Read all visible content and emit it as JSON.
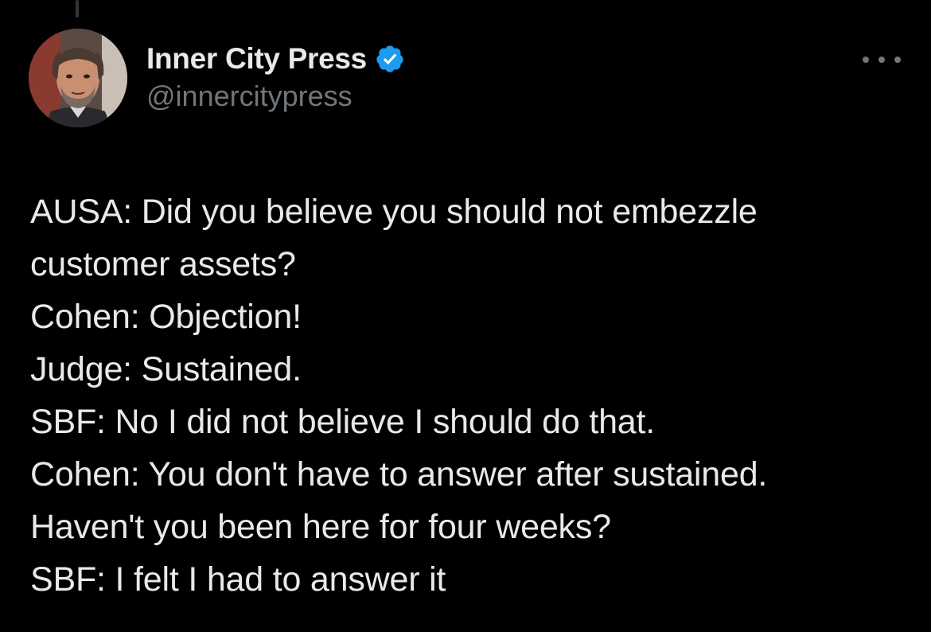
{
  "tweet": {
    "author": {
      "display_name": "Inner City Press",
      "handle": "@innercitypress",
      "verified": true,
      "avatar_icon": "person-portrait"
    },
    "more_icon": "more-options-icon",
    "lines": [
      "AUSA: Did you believe you should not embezzle",
      "customer assets?",
      "Cohen: Objection!",
      "Judge: Sustained.",
      "SBF: No I did not believe I should do that.",
      "Cohen: You don't have to answer after sustained.",
      "Haven't you been here for four weeks?",
      "SBF: I felt I had to answer it"
    ]
  },
  "colors": {
    "background": "#000000",
    "text_primary": "#e7e9ea",
    "text_secondary": "#71767b",
    "verified_blue": "#1d9bf0",
    "thread_line": "#333639"
  }
}
